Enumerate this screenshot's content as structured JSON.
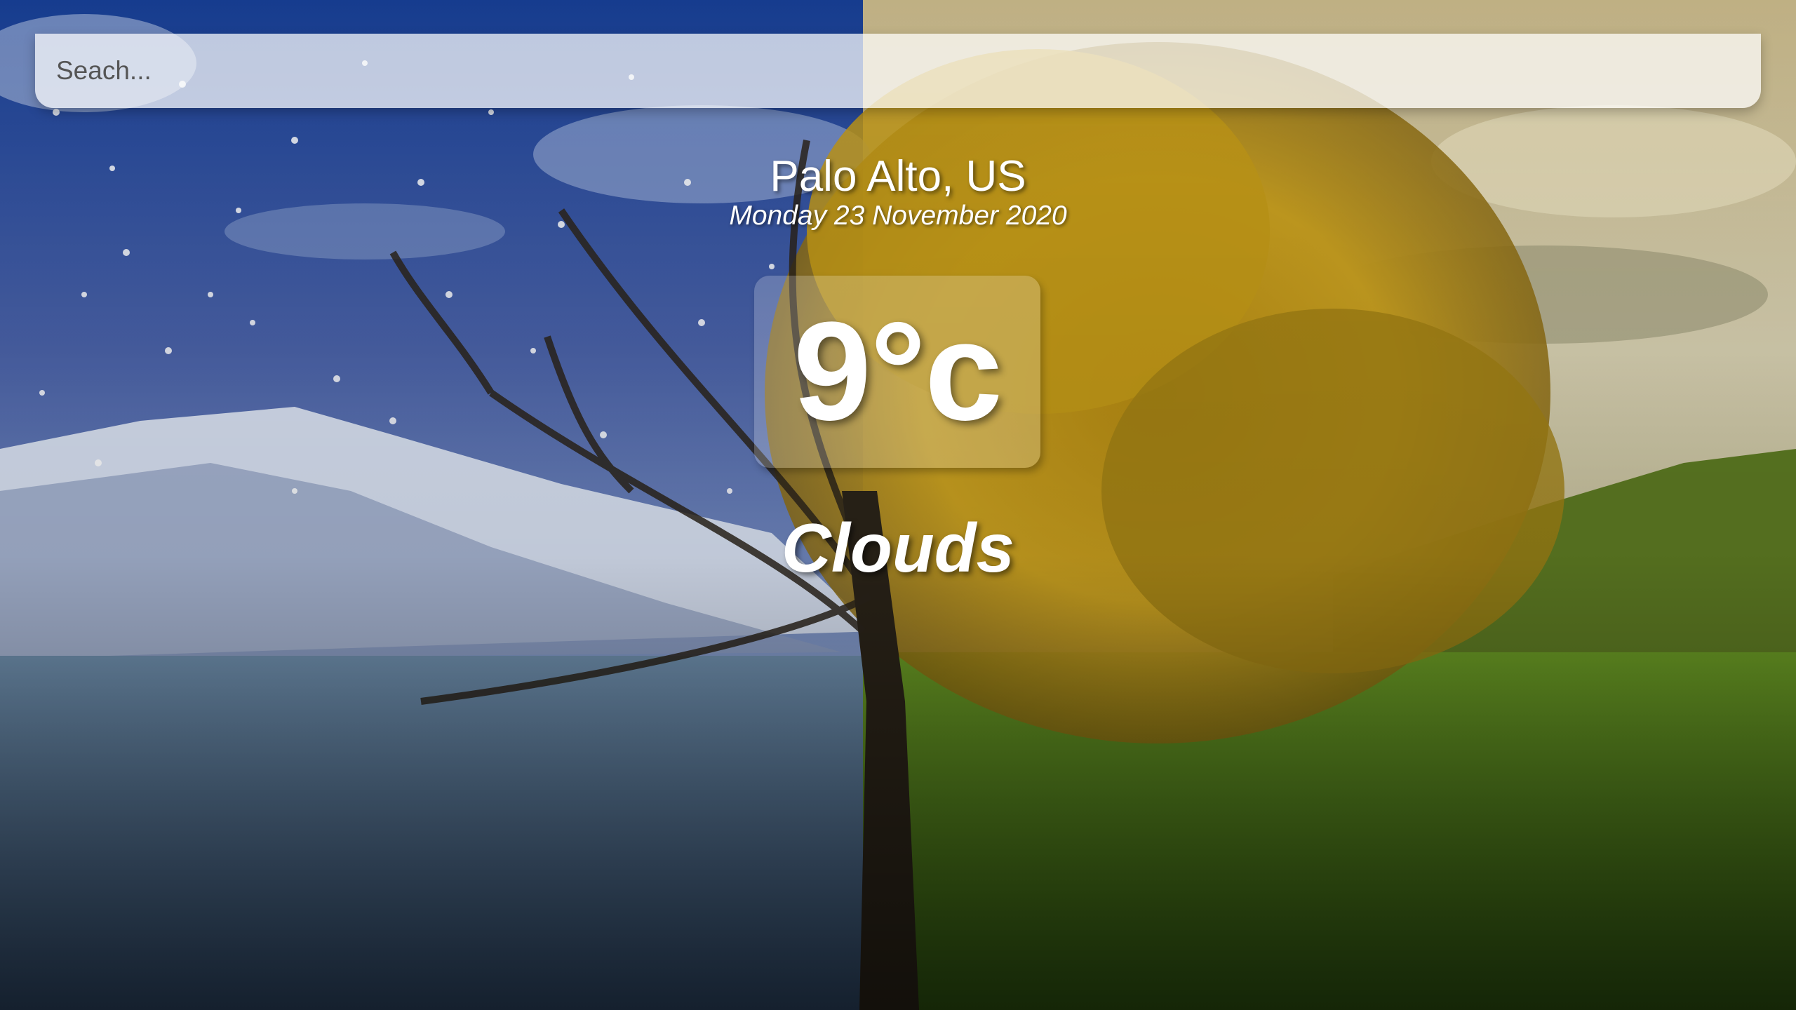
{
  "search": {
    "placeholder": "Seach...",
    "value": ""
  },
  "location": {
    "city_country": "Palo Alto, US",
    "date": "Monday 23 November 2020"
  },
  "weather": {
    "temperature": "9°c",
    "condition": "Clouds"
  },
  "background": {
    "description_icon": "seasons-tree-landscape",
    "colors": {
      "winter_sky": "#1a3f8a",
      "autumn_foliage": "#c99a1a",
      "grass": "#4f8a1c"
    }
  }
}
